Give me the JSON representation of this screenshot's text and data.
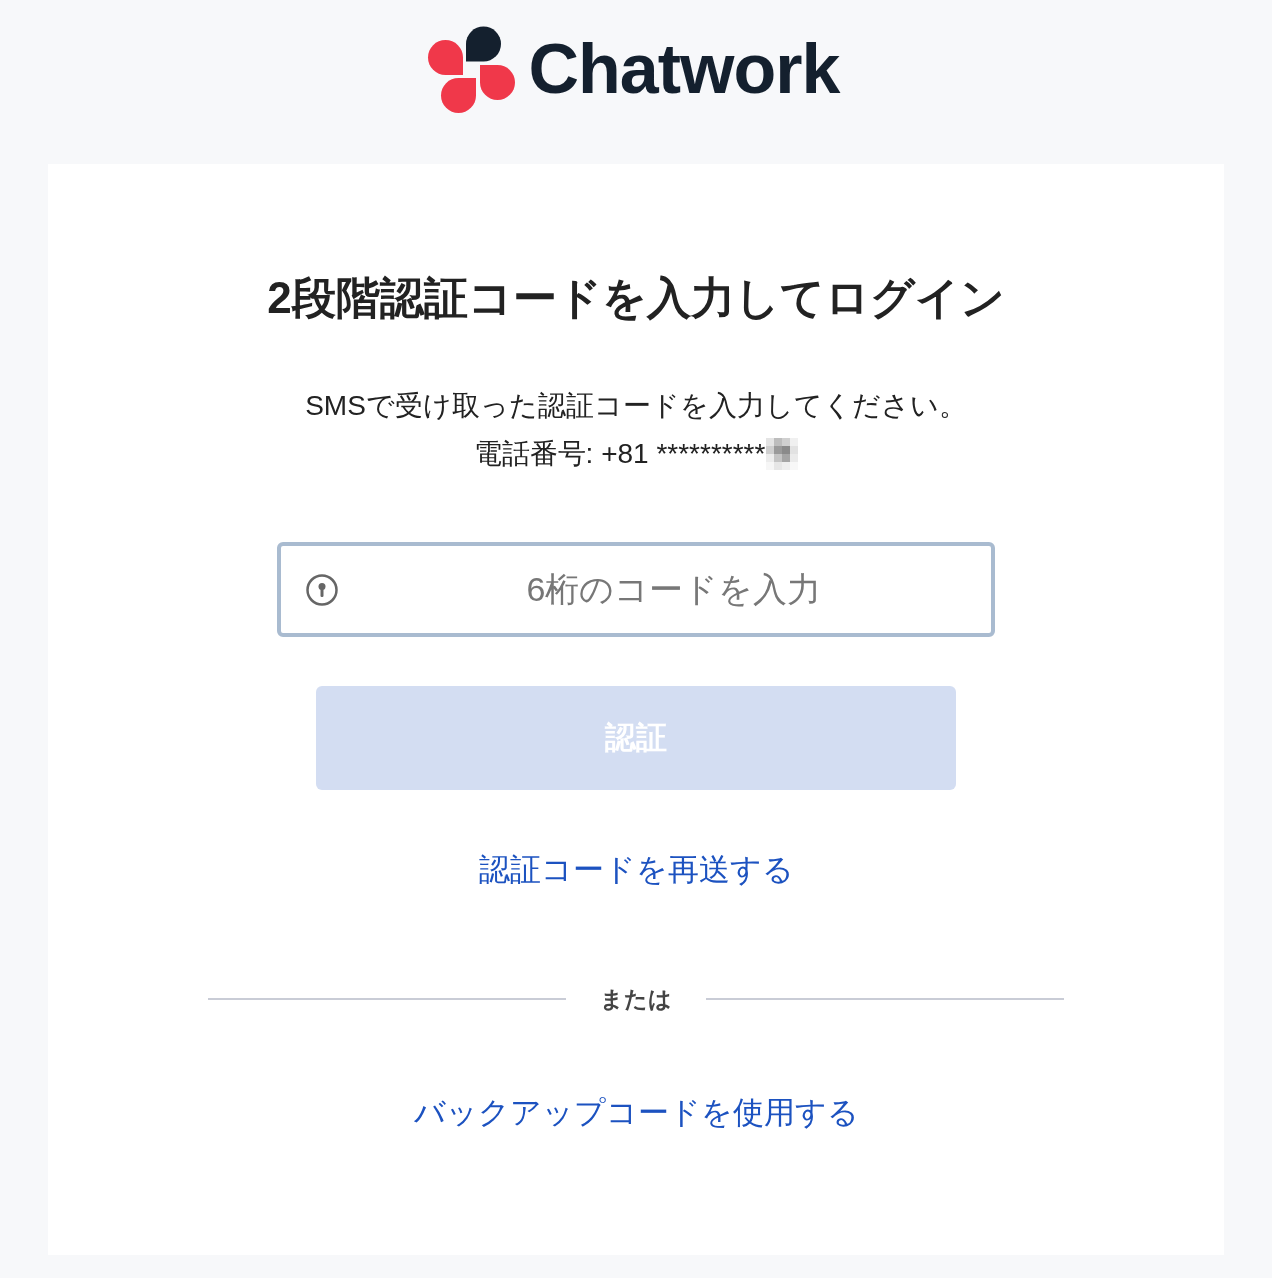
{
  "logo": {
    "text": "Chatwork"
  },
  "title": "2段階認証コードを入力してログイン",
  "instruction": "SMSで受け取った認証コードを入力してください。",
  "phone": {
    "text": "電話番号: +81 **********",
    "redacted": true
  },
  "code_field": {
    "placeholder": "6桁のコードを入力"
  },
  "verify_button": {
    "label": "認証",
    "disabled": true
  },
  "resend_link": "認証コードを再送する",
  "divider": {
    "label": "または"
  },
  "backup_link": "バックアップコードを使用する"
}
